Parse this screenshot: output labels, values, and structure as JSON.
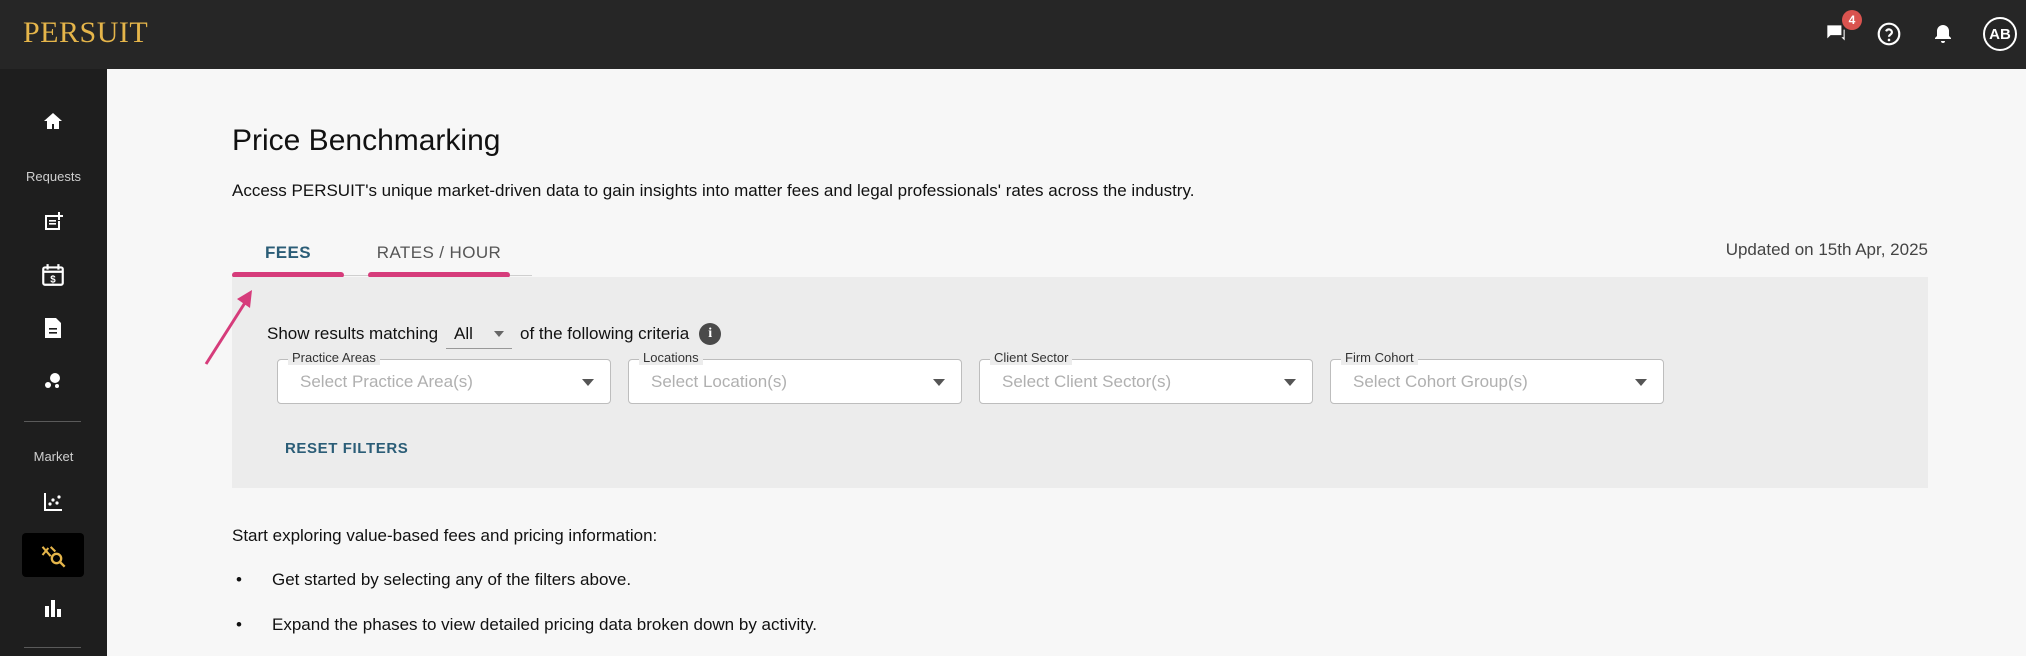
{
  "app": {
    "logo": "PERSUIT",
    "brand_color": "#e5b54a",
    "accent_color": "#d63c7b"
  },
  "topbar": {
    "messages_icon": "chat-icon",
    "messages_count": "4",
    "help_icon": "help-icon",
    "notifications_icon": "bell-icon",
    "avatar_initials": "AB"
  },
  "sidebar": {
    "sections": {
      "requests": "Requests",
      "market": "Market"
    },
    "items": [
      {
        "icon": "home-icon"
      },
      {
        "icon": "new-request-icon"
      },
      {
        "icon": "calendar-dollar-icon"
      },
      {
        "icon": "document-icon"
      },
      {
        "icon": "bubbles-icon"
      },
      {
        "icon": "scatter-chart-icon"
      },
      {
        "icon": "price-benchmark-icon",
        "active": true
      },
      {
        "icon": "bar-chart-icon"
      }
    ]
  },
  "main": {
    "title": "Price Benchmarking",
    "description": "Access PERSUIT's unique market-driven data to gain insights into matter fees and legal professionals' rates across the industry.",
    "tabs": [
      {
        "label": "FEES",
        "active": true
      },
      {
        "label": "RATES / HOUR",
        "active": false
      }
    ],
    "updated": "Updated on 15th Apr, 2025"
  },
  "filters": {
    "match_prefix": "Show results matching",
    "match_value": "All",
    "match_suffix": "of the following criteria",
    "fields": [
      {
        "label": "Practice Areas",
        "placeholder": "Select Practice Area(s)"
      },
      {
        "label": "Locations",
        "placeholder": "Select Location(s)"
      },
      {
        "label": "Client Sector",
        "placeholder": "Select Client Sector(s)"
      },
      {
        "label": "Firm Cohort",
        "placeholder": "Select Cohort Group(s)"
      }
    ],
    "reset_label": "RESET FILTERS"
  },
  "intro": {
    "text": "Start exploring value-based fees and pricing information:",
    "bullets": [
      "Get started by selecting any of the filters above.",
      "Expand the phases to view detailed pricing data broken down by activity."
    ]
  }
}
